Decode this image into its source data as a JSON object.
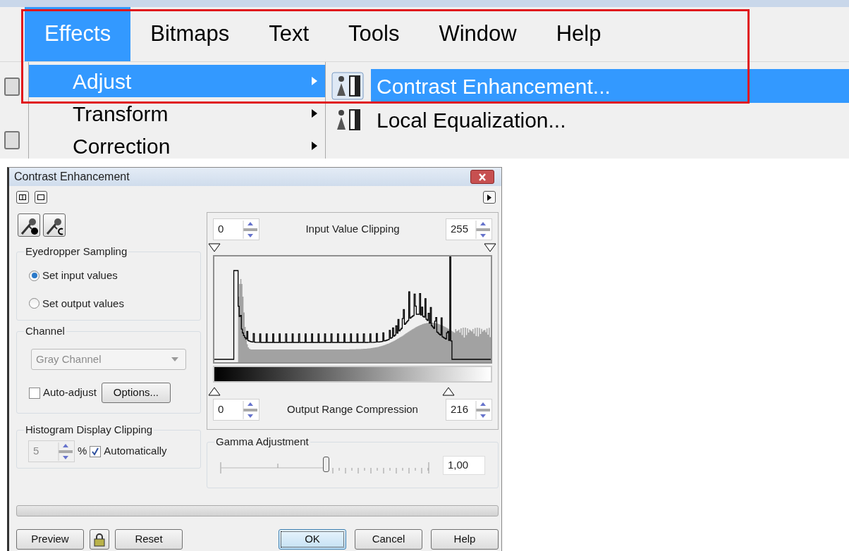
{
  "menubar": {
    "items": [
      {
        "label": "Effects",
        "selected": true
      },
      {
        "label": "Bitmaps",
        "selected": false
      },
      {
        "label": "Text",
        "selected": false
      },
      {
        "label": "Tools",
        "selected": false
      },
      {
        "label": "Window",
        "selected": false
      },
      {
        "label": "Help",
        "selected": false
      }
    ]
  },
  "menu": {
    "items": [
      {
        "label": "Adjust",
        "selected": true
      },
      {
        "label": "Transform",
        "selected": false
      },
      {
        "label": "Correction",
        "selected": false
      }
    ]
  },
  "submenu": {
    "items": [
      {
        "label": "Contrast Enhancement...",
        "selected": true
      },
      {
        "label": "Local Equalization...",
        "selected": false
      }
    ]
  },
  "dialog": {
    "title": "Contrast Enhancement",
    "eyedropper_sampling": {
      "title": "Eyedropper Sampling",
      "options": [
        {
          "label": "Set input values",
          "selected": true
        },
        {
          "label": "Set output values",
          "selected": false
        }
      ]
    },
    "channel": {
      "title": "Channel",
      "dropdown": {
        "value": "Gray Channel",
        "disabled": true
      },
      "auto_adjust": {
        "label": "Auto-adjust",
        "checked": false
      },
      "options_button": "Options..."
    },
    "histogram_display_clipping": {
      "title": "Histogram Display Clipping",
      "value": "5",
      "unit": "%",
      "disabled": true,
      "automatically": {
        "label": "Automatically",
        "checked": true
      }
    },
    "input_value_clipping": {
      "label": "Input Value Clipping",
      "low": "0",
      "high": "255"
    },
    "output_range_compression": {
      "label": "Output Range Compression",
      "low": "0",
      "high": "216"
    },
    "gamma_adjustment": {
      "title": "Gamma Adjustment",
      "level": 0.5,
      "value": "1,00"
    },
    "progress": {
      "level": 0
    },
    "left_buttons": [
      "Preview",
      "Reset"
    ],
    "right_buttons": [
      {
        "label": "OK",
        "focused": true
      },
      {
        "label": "Cancel",
        "focused": false
      },
      {
        "label": "Help",
        "focused": false
      }
    ]
  }
}
